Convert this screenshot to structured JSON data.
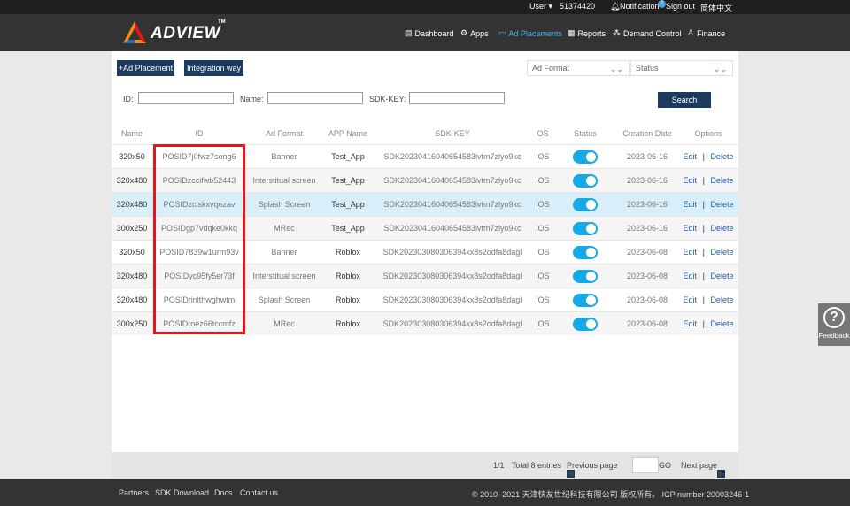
{
  "topbar": {
    "user_label": "User",
    "user_id": "51374420",
    "notification_label": "Notification",
    "notification_count": "2",
    "signout_label": "Sign out",
    "language_label": "简体中文"
  },
  "brand": {
    "name": "ADVIEW",
    "tm": "TM"
  },
  "nav": [
    {
      "label": "Dashboard",
      "icon": "document-icon"
    },
    {
      "label": "Apps",
      "icon": "gear-icon"
    },
    {
      "label": "Ad Placements",
      "icon": "monitor-icon",
      "active": true
    },
    {
      "label": "Reports",
      "icon": "table-icon"
    },
    {
      "label": "Demand Control",
      "icon": "network-icon"
    },
    {
      "label": "Finance",
      "icon": "person-icon"
    }
  ],
  "toolbar": {
    "add_label": "+Ad Placement",
    "integration_label": "Integration way",
    "ad_format_label": "Ad Format",
    "status_label": "Status"
  },
  "filters": {
    "id_label": "ID:",
    "name_label": "Name:",
    "sdk_label": "SDK-KEY:",
    "id_value": "",
    "name_value": "",
    "sdk_value": "",
    "search_label": "Search"
  },
  "table": {
    "columns": [
      "Name",
      "ID",
      "Ad Format",
      "APP Name",
      "SDK-KEY",
      "OS",
      "Status",
      "Creation Date",
      "Options"
    ],
    "rows": [
      {
        "name": "320x50",
        "id": "POSID7j0fwz7song6",
        "format": "Banner",
        "app": "Test_App",
        "sdk": "SDK20230416040654583ivtm7zlyo9kc",
        "os": "iOS",
        "status": "on",
        "date": "2023-06-16"
      },
      {
        "name": "320x480",
        "id": "POSIDzccifwb52443",
        "format": "Interstitual screen",
        "app": "Test_App",
        "sdk": "SDK20230416040654583ivtm7zlyo9kc",
        "os": "iOS",
        "status": "on",
        "date": "2023-06-16"
      },
      {
        "name": "320x480",
        "id": "POSIDzclskxvqozav",
        "format": "Splash Screen",
        "app": "Test_App",
        "sdk": "SDK20230416040654583ivtm7zlyo9kc",
        "os": "iOS",
        "status": "on",
        "date": "2023-06-16"
      },
      {
        "name": "300x250",
        "id": "POSIDgp7vdqke0kkq",
        "format": "MRec",
        "app": "Test_App",
        "sdk": "SDK20230416040654583ivtm7zlyo9kc",
        "os": "iOS",
        "status": "on",
        "date": "2023-06-16"
      },
      {
        "name": "320x50",
        "id": "POSID7839w1urm93v",
        "format": "Banner",
        "app": "Roblox",
        "sdk": "SDK202303080306394kx8s2odfa8dagl",
        "os": "iOS",
        "status": "on",
        "date": "2023-06-08"
      },
      {
        "name": "320x480",
        "id": "POSIDyc95fy5er73f",
        "format": "Interstitual screen",
        "app": "Roblox",
        "sdk": "SDK202303080306394kx8s2odfa8dagl",
        "os": "iOS",
        "status": "on",
        "date": "2023-06-08"
      },
      {
        "name": "320x480",
        "id": "POSIDrinlthwghwtm",
        "format": "Splash Screen",
        "app": "Roblox",
        "sdk": "SDK202303080306394kx8s2odfa8dagl",
        "os": "iOS",
        "status": "on",
        "date": "2023-06-08"
      },
      {
        "name": "300x250",
        "id": "POSIDroez66tccmfz",
        "format": "MRec",
        "app": "Roblox",
        "sdk": "SDK202303080306394kx8s2odfa8dagl",
        "os": "iOS",
        "status": "on",
        "date": "2023-06-08"
      }
    ],
    "edit_label": "Edit",
    "separator": "|",
    "delete_label": "Delete"
  },
  "pager": {
    "page_info": "1/1",
    "total": "Total 8 entries",
    "prev_label": "Previous page",
    "go_label": "GO",
    "next_label": "Next page",
    "page_input": ""
  },
  "footer": {
    "links": [
      "Partners",
      "SDK Download",
      "Docs",
      "Contact us"
    ],
    "copyright": "© 2010–2021 天津快友世纪科技有限公司 版权所有。 ICP number 20003246-1"
  },
  "feedback": {
    "label": "Feedback",
    "icon": "question-icon"
  },
  "colors": {
    "accent": "#1c3a5e",
    "toggle": "#17a8e8",
    "highlight_row": "#d8eef8",
    "annotation_box": "#e8141c"
  }
}
